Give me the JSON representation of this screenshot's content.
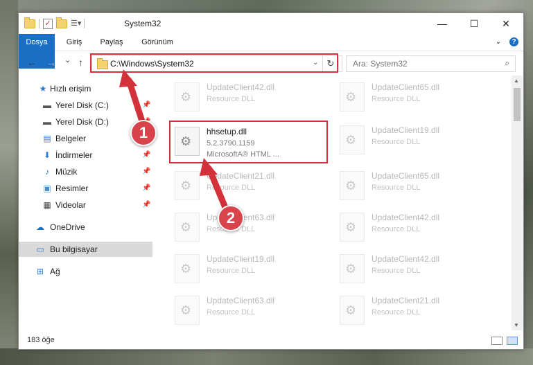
{
  "window": {
    "title": "System32"
  },
  "titlebar": {
    "minimize": "—",
    "maximize": "☐",
    "close": "✕"
  },
  "ribbon": {
    "tabs": [
      {
        "label": "Dosya"
      },
      {
        "label": "Giriş"
      },
      {
        "label": "Paylaş"
      },
      {
        "label": "Görünüm"
      }
    ],
    "help": "?"
  },
  "nav": {
    "back": "←",
    "forward": "→",
    "recent": "⌄",
    "up": "↑",
    "address": "C:\\Windows\\System32",
    "address_dropdown": "⌄",
    "refresh": "↻",
    "search_placeholder": "Ara: System32",
    "search_icon": "⌕"
  },
  "sidebar": {
    "items": [
      {
        "label": "Hızlı erişim",
        "icon": "star-icon"
      },
      {
        "label": "Yerel Disk (C:)",
        "icon": "drive-icon",
        "pinned": true
      },
      {
        "label": "Yerel Disk (D:)",
        "icon": "drive-icon",
        "pinned": true
      },
      {
        "label": "Belgeler",
        "icon": "documents-icon",
        "pinned": true
      },
      {
        "label": "İndirmeler",
        "icon": "download-icon",
        "pinned": true
      },
      {
        "label": "Müzik",
        "icon": "music-icon",
        "pinned": true
      },
      {
        "label": "Resimler",
        "icon": "pictures-icon",
        "pinned": true
      },
      {
        "label": "Videolar",
        "icon": "video-icon",
        "pinned": true
      },
      {
        "label": "OneDrive",
        "icon": "cloud-icon"
      },
      {
        "label": "Bu bilgisayar",
        "icon": "computer-icon",
        "selected": true
      },
      {
        "label": "Ağ",
        "icon": "network-icon"
      }
    ]
  },
  "files": {
    "left": [
      {
        "name": "UpdateClient42.dll",
        "desc": "Resource DLL"
      },
      {
        "name": "hhsetup.dll",
        "desc": "5.2.3790.1159",
        "desc2": "MicrosoftA® HTML ...",
        "highlight": true
      },
      {
        "name": "UpdateClient21.dll",
        "desc": "Resource DLL"
      },
      {
        "name": "UpdateClient63.dll",
        "desc": "Resource DLL"
      },
      {
        "name": "UpdateClient19.dll",
        "desc": "Resource DLL"
      },
      {
        "name": "UpdateClient63.dll",
        "desc": "Resource DLL"
      }
    ],
    "right": [
      {
        "name": "UpdateClient65.dll",
        "desc": "Resource DLL"
      },
      {
        "name": "UpdateClient19.dll",
        "desc": "Resource DLL"
      },
      {
        "name": "UpdateClient65.dll",
        "desc": "Resource DLL"
      },
      {
        "name": "UpdateClient42.dll",
        "desc": "Resource DLL"
      },
      {
        "name": "UpdateClient42.dll",
        "desc": "Resource DLL"
      },
      {
        "name": "UpdateClient21.dll",
        "desc": "Resource DLL"
      }
    ]
  },
  "status": {
    "count": "183 öğe"
  },
  "annotations": {
    "step1": "1",
    "step2": "2"
  },
  "colors": {
    "accent": "#1a6fc5",
    "annotation": "#d4323a"
  }
}
